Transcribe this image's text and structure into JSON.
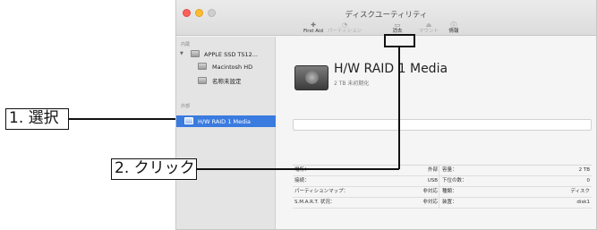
{
  "window": {
    "title": "ディスクユーティリティ"
  },
  "toolbar": {
    "first_aid": {
      "icon": "stethoscope-icon",
      "label": "First Aid"
    },
    "partition": {
      "icon": "pie-partition-icon",
      "label": "パーティション"
    },
    "erase": {
      "icon": "erase-icon",
      "label": "消去"
    },
    "mount": {
      "icon": "mount-icon",
      "label": "マウント"
    },
    "info": {
      "icon": "info-icon",
      "label": "情報"
    }
  },
  "sidebar": {
    "internal_label": "内蔵",
    "external_label": "外部",
    "items": [
      {
        "label": "APPLE SSD TS12...",
        "icon": "disk-icon",
        "expanded": true
      },
      {
        "label": "Macintosh HD",
        "icon": "volume-icon"
      },
      {
        "label": "名称未設定",
        "icon": "volume-icon"
      },
      {
        "label": "H/W RAID 1 Media",
        "icon": "disk-icon",
        "selected": true
      }
    ]
  },
  "volume": {
    "name": "H/W RAID 1 Media",
    "subtitle": "2 TB 未初期化"
  },
  "info_table": {
    "rows": [
      {
        "left_key": "場所：",
        "left_value": "外部",
        "right_key": "容量：",
        "right_value": "2 TB"
      },
      {
        "left_key": "接続：",
        "left_value": "USB",
        "right_key": "下位の数：",
        "right_value": "0"
      },
      {
        "left_key": "パーティションマップ：",
        "left_value": "非対応",
        "right_key": "種類：",
        "right_value": "ディスク"
      },
      {
        "left_key": "S.M.A.R.T. 状況：",
        "left_value": "非対応",
        "right_key": "装置：",
        "right_value": "disk1"
      }
    ]
  },
  "callouts": {
    "step1": "1. 選択",
    "step2": "2. クリック"
  },
  "colors": {
    "selection": "#3a7be0",
    "close": "#fc5f57",
    "minimize": "#fdbd2e"
  }
}
